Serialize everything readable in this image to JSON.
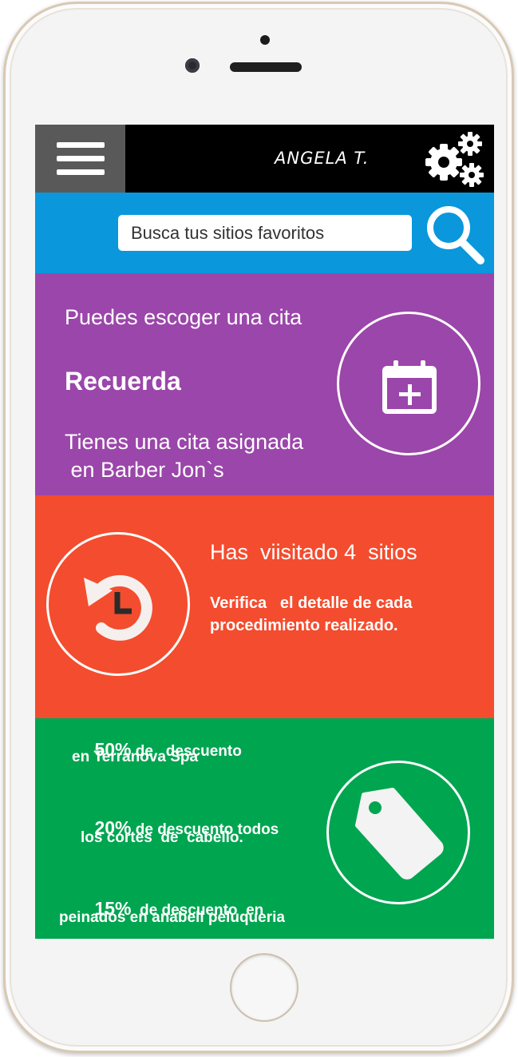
{
  "header": {
    "user_name": "ANGELA T."
  },
  "search": {
    "placeholder": "Busca tus sitios favoritos"
  },
  "appointment": {
    "choose_text": "Puedes escoger una cita",
    "heading": "Recuerda",
    "line1": "Tienes una cita asignada",
    "line2": " en Barber Jon`s"
  },
  "history": {
    "visited": "Has  viisitado 4  sitios",
    "detail_line1": "Verifica   el detalle de cada",
    "detail_line2": "procedimiento realizado."
  },
  "discounts": {
    "items": [
      {
        "percent": "50%",
        "line1": " de   descuento",
        "line2": "en Terranova Spa"
      },
      {
        "percent": "20%",
        "line1": " de descuento todos",
        "line2": "los cortes  de  cabello."
      },
      {
        "percent": "15%",
        "line1": "  de descuento  en",
        "line2": "peinados en anabell peluqueria"
      }
    ]
  },
  "colors": {
    "topbar": "#000000",
    "menu_button": "#595959",
    "search_bar": "#0a97dc",
    "appointment_panel": "#9b46aa",
    "history_panel": "#f44c2e",
    "discounts_panel": "#00a550"
  },
  "icons": {
    "menu": "hamburger-menu-icon",
    "settings": "gears-icon",
    "search": "magnifier-icon",
    "appointment": "calendar-add-icon",
    "history": "history-clock-icon",
    "discounts": "price-tag-icon"
  }
}
